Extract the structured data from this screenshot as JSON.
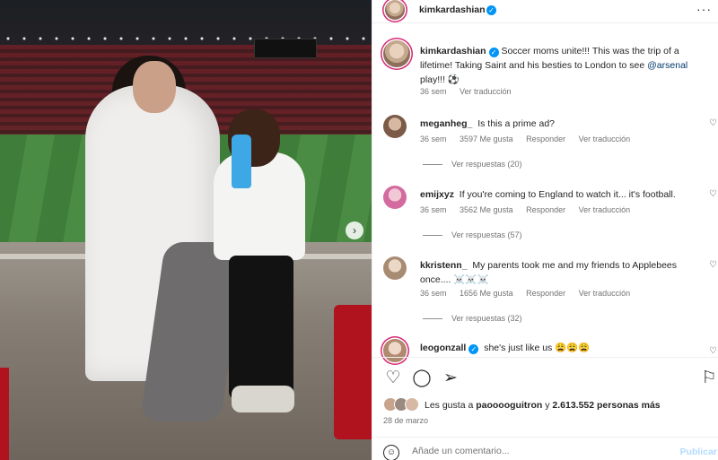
{
  "post": {
    "header": {
      "username": "kimkardashian",
      "more_icon": "more-horizontal-icon"
    },
    "caption": {
      "username": "kimkardashian",
      "text_before": "Soccer moms unite!!! This was the trip of a lifetime! Taking Saint and his besties to London to see ",
      "mention": "@arsenal",
      "text_after": " play!!! ⚽",
      "time": "36 sem",
      "translate": "Ver traducción"
    },
    "comments": [
      {
        "username": "meganheg_",
        "text": "Is this a prime ad?",
        "time": "36 sem",
        "likes": "3597 Me gusta",
        "reply": "Responder",
        "translate": "Ver traducción",
        "replies": "Ver respuestas (20)"
      },
      {
        "username": "emijxyz",
        "text": "If you're coming to England to watch it... it's football.",
        "time": "36 sem",
        "likes": "3562 Me gusta",
        "reply": "Responder",
        "translate": "Ver traducción",
        "replies": "Ver respuestas (57)"
      },
      {
        "username": "kkristenn_",
        "text": "My parents took me and my friends to Applebees once.... ☠️☠️☠️",
        "time": "36 sem",
        "likes": "1656 Me gusta",
        "reply": "Responder",
        "translate": "Ver traducción",
        "replies": "Ver respuestas (32)"
      },
      {
        "username": "leogonzall",
        "text": "she's just like us 😩😩😩",
        "verified": true
      }
    ],
    "likes": {
      "prefix": "Les gusta a ",
      "user": "paooooguitron",
      "mid": " y ",
      "count": "2.613.552 personas más"
    },
    "date": "28 de marzo",
    "add_comment": {
      "placeholder": "Añade un comentario...",
      "post_label": "Publicar"
    },
    "colors": {
      "accent": "#0095f6",
      "link": "#00376b",
      "muted": "#737373",
      "post_disabled": "#b3dbff"
    }
  }
}
